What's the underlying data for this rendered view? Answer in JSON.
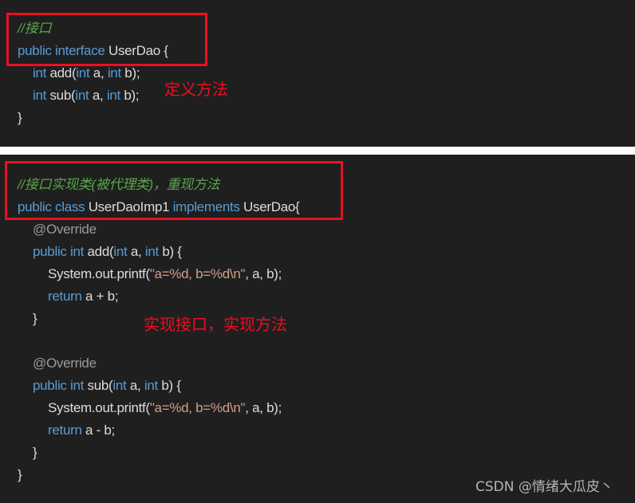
{
  "panels": [
    {
      "lines": [
        {
          "segments": [
            {
              "t": "//接口",
              "c": "cm"
            }
          ]
        },
        {
          "segments": [
            {
              "t": "public interface ",
              "c": "kw"
            },
            {
              "t": "UserDao {",
              "c": "plain"
            }
          ]
        },
        {
          "segments": [
            {
              "t": "int",
              "c": "kw"
            },
            {
              "t": " add(",
              "c": "plain"
            },
            {
              "t": "int",
              "c": "kw"
            },
            {
              "t": " a, ",
              "c": "plain"
            },
            {
              "t": "int",
              "c": "kw"
            },
            {
              "t": " b);",
              "c": "plain"
            }
          ]
        },
        {
          "segments": [
            {
              "t": "int",
              "c": "kw"
            },
            {
              "t": " sub(",
              "c": "plain"
            },
            {
              "t": "int",
              "c": "kw"
            },
            {
              "t": " a, ",
              "c": "plain"
            },
            {
              "t": "int",
              "c": "kw"
            },
            {
              "t": " b);",
              "c": "plain"
            }
          ]
        },
        {
          "segments": [
            {
              "t": "}",
              "c": "plain"
            }
          ]
        }
      ],
      "annotation": "定义方法"
    },
    {
      "lines": [
        {
          "segments": [
            {
              "t": "//接口实现类(被代理类)，重现方法",
              "c": "cm"
            }
          ]
        },
        {
          "segments": [
            {
              "t": "public class ",
              "c": "kw"
            },
            {
              "t": "UserDaoImp1 ",
              "c": "plain"
            },
            {
              "t": "implements ",
              "c": "kw"
            },
            {
              "t": "UserDao{",
              "c": "plain"
            }
          ]
        },
        {
          "segments": [
            {
              "t": "@Override",
              "c": "ann"
            }
          ]
        },
        {
          "segments": [
            {
              "t": "public int ",
              "c": "kw"
            },
            {
              "t": "add(",
              "c": "plain"
            },
            {
              "t": "int",
              "c": "kw"
            },
            {
              "t": " a, ",
              "c": "plain"
            },
            {
              "t": "int",
              "c": "kw"
            },
            {
              "t": " b) {",
              "c": "plain"
            }
          ]
        },
        {
          "segments": [
            {
              "t": "System.out.printf(",
              "c": "plain"
            },
            {
              "t": "\"a=%d, b=%d\\n\"",
              "c": "str"
            },
            {
              "t": ", a, b);",
              "c": "plain"
            }
          ]
        },
        {
          "segments": [
            {
              "t": "return",
              "c": "kw"
            },
            {
              "t": " a + b;",
              "c": "plain"
            }
          ]
        },
        {
          "segments": [
            {
              "t": "}",
              "c": "plain"
            }
          ]
        },
        {
          "segments": []
        },
        {
          "segments": [
            {
              "t": "@Override",
              "c": "ann"
            }
          ]
        },
        {
          "segments": [
            {
              "t": "public int ",
              "c": "kw"
            },
            {
              "t": "sub(",
              "c": "plain"
            },
            {
              "t": "int",
              "c": "kw"
            },
            {
              "t": " a, ",
              "c": "plain"
            },
            {
              "t": "int",
              "c": "kw"
            },
            {
              "t": " b) {",
              "c": "plain"
            }
          ]
        },
        {
          "segments": [
            {
              "t": "System.out.printf(",
              "c": "plain"
            },
            {
              "t": "\"a=%d, b=%d\\n\"",
              "c": "str"
            },
            {
              "t": ", a, b);",
              "c": "plain"
            }
          ]
        },
        {
          "segments": [
            {
              "t": "return",
              "c": "kw"
            },
            {
              "t": " a - b;",
              "c": "plain"
            }
          ]
        },
        {
          "segments": [
            {
              "t": "}",
              "c": "plain"
            }
          ]
        },
        {
          "segments": [
            {
              "t": "}",
              "c": "plain"
            }
          ]
        }
      ],
      "annotation": "实现接口，实现方法"
    }
  ],
  "watermark": "CSDN @情绪大瓜皮丶",
  "colors": {
    "background": "#1f1f1f",
    "keyword": "#569cd6",
    "comment": "#57a64a",
    "string": "#d69d85",
    "annotation": "#9b9b9b",
    "highlight": "#e81123"
  }
}
